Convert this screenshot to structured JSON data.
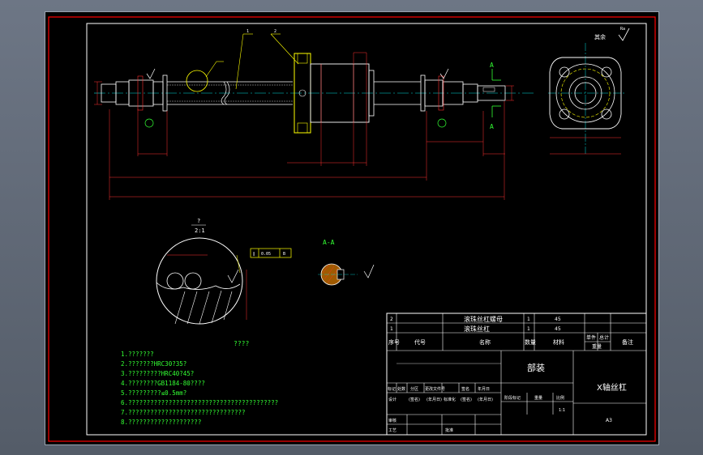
{
  "drawing": {
    "section_label": "A-A",
    "view_arrow_label": "A",
    "detail_label_top": "?",
    "detail_label_bottom": "2:1",
    "detail_caption": "????",
    "surface_finish": "Ra",
    "surface_finish_other": "其余",
    "tolerance_frame": [
      "∥",
      "0.05",
      "B"
    ],
    "balloons": [
      "1",
      "2"
    ]
  },
  "notes": [
    "1.???????",
    "2.???????HRC30?35?",
    "3.?????????HRC40?45?",
    "4.????????GB1184-80????",
    "5.?????????≤0.5mm?",
    "6.?????????????????????????????????????????",
    "7.????????????????????????????????",
    "8.????????????????????"
  ],
  "title_block": {
    "parts_rows": [
      {
        "no": "2",
        "code": "",
        "name": "滚珠丝杠螺母",
        "qty": "1",
        "material": "45",
        "weight": "",
        "remark": ""
      },
      {
        "no": "1",
        "code": "",
        "name": "滚珠丝杠",
        "qty": "1",
        "material": "45",
        "weight": "",
        "remark": ""
      }
    ],
    "headers": {
      "no": "序号",
      "code": "代号",
      "name": "名称",
      "qty": "数量",
      "material": "材料",
      "unit_weight": "单件",
      "total_weight": "总计",
      "weight": "重量",
      "remark": "备注"
    },
    "assembly_label": "部装",
    "drawing_title": "X轴丝杠",
    "revision_labels": [
      "标记",
      "处数",
      "分区",
      "更改文件号",
      "签名",
      "年月日"
    ],
    "approval_labels": [
      "设计",
      "(签名)",
      "(年月日)",
      "标准化",
      "(签名)",
      "(年月日)"
    ],
    "stage_label": "阶段标记",
    "weight_label": "重量",
    "scale_label": "比例",
    "scale_value": "1:1",
    "review_label": "审核",
    "process_label": "工艺",
    "approve_label": "批准",
    "sheet_size": "A3"
  },
  "colors": {
    "outline": "#ffffff",
    "dimension": "#ff3030",
    "center_line": "#00e0e0",
    "annotation": "#ffff00",
    "text_green": "#33ff33",
    "frame_red": "#ff0000"
  }
}
